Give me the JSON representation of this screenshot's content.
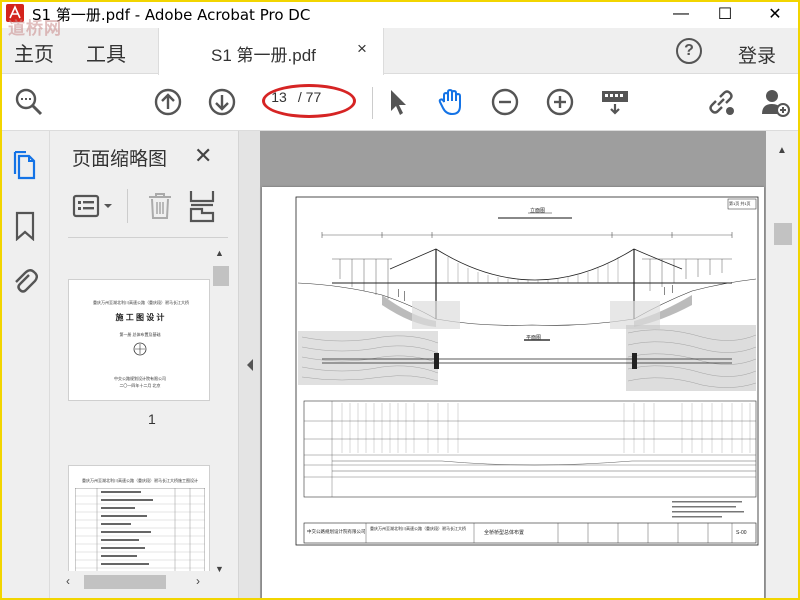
{
  "window": {
    "title": "S1    第一册.pdf - Adobe Acrobat Pro DC",
    "minimize": "—",
    "maximize": "☐",
    "close": "✕",
    "watermark": "道桥网"
  },
  "menu": {
    "home": "主页",
    "tools": "工具",
    "tab_label": "S1    第一册.pdf",
    "tab_close": "×",
    "help": "?",
    "login": "登录"
  },
  "toolbar": {
    "page_current": "13",
    "page_total": "/ 77"
  },
  "panel": {
    "title": "页面缩略图",
    "close": "✕",
    "thumb1_number": "1",
    "thumb1": {
      "header": "重庆万州至湖北利川高速公路（重庆段）驸马长江大桥",
      "title": "施  工  图  设  计",
      "subtitle": "第一册  总体布置及基础",
      "company": "中交公路规划设计院有限公司",
      "date": "二〇一四年十二月  北京"
    },
    "thumb2": {
      "header": "重庆万州至湖北利川高速公路（重庆段）驸马长江大桥施工图设计"
    }
  },
  "drawing": {
    "title_elevation": "立面图",
    "title_plan": "平面图",
    "footer_company": "中交公路规划设计院有限公司",
    "footer_project": "重庆万州至湖北利川高速公路（重庆段）驸马长江大桥",
    "footer_sheet": "全桥桥型总体布置",
    "sheet_code": "S-00",
    "page_no": "第1页 共1页"
  }
}
